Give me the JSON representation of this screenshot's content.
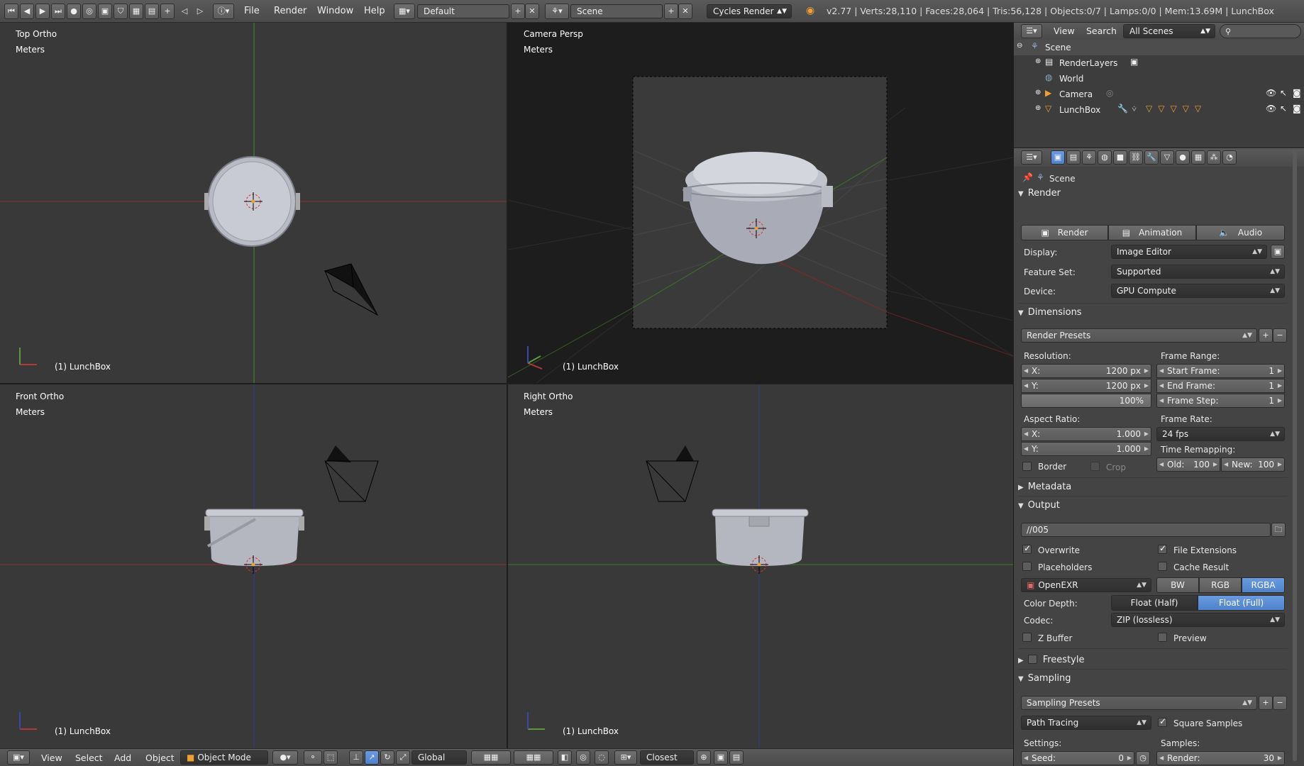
{
  "header": {
    "menus": [
      "File",
      "Render",
      "Window",
      "Help"
    ],
    "screen_layout": "Default",
    "scene": "Scene",
    "engine": "Cycles Render",
    "stats": "v2.77 | Verts:28,110 | Faces:28,064 | Tris:56,128 | Objects:0/7 | Lamps:0/0 | Mem:13.69M | LunchBox"
  },
  "viewports": {
    "top_left": {
      "view": "Top Ortho",
      "units": "Meters",
      "object": "(1) LunchBox"
    },
    "top_right": {
      "view": "Camera Persp",
      "units": "Meters",
      "object": "(1) LunchBox"
    },
    "bottom_left": {
      "view": "Front Ortho",
      "units": "Meters",
      "object": "(1) LunchBox"
    },
    "bottom_right": {
      "view": "Right Ortho",
      "units": "Meters",
      "object": "(1) LunchBox"
    }
  },
  "footer": {
    "menus": [
      "View",
      "Select",
      "Add",
      "Object"
    ],
    "mode": "Object Mode",
    "orientation": "Global",
    "snap": "Closest"
  },
  "outliner": {
    "menus": [
      "View",
      "Search"
    ],
    "filter": "All Scenes",
    "items": [
      "Scene",
      "RenderLayers",
      "World",
      "Camera",
      "LunchBox"
    ]
  },
  "properties": {
    "context": "Scene",
    "render": {
      "title": "Render",
      "buttons": [
        "Render",
        "Animation",
        "Audio"
      ],
      "display_label": "Display:",
      "display": "Image Editor",
      "feature_label": "Feature Set:",
      "feature": "Supported",
      "device_label": "Device:",
      "device": "GPU Compute"
    },
    "dimensions": {
      "title": "Dimensions",
      "presets": "Render Presets",
      "resolution_label": "Resolution:",
      "res_x_key": "X:",
      "res_x": "1200 px",
      "res_y_key": "Y:",
      "res_y": "1200 px",
      "res_pct": "100%",
      "frame_range_label": "Frame Range:",
      "start_key": "Start Frame:",
      "start": "1",
      "end_key": "End Frame:",
      "end": "1",
      "step_key": "Frame Step:",
      "step": "1",
      "aspect_label": "Aspect Ratio:",
      "asp_x_key": "X:",
      "asp_x": "1.000",
      "asp_y_key": "Y:",
      "asp_y": "1.000",
      "frame_rate_label": "Frame Rate:",
      "frame_rate": "24 fps",
      "time_remap_label": "Time Remapping:",
      "old_key": "Old:",
      "old": "100",
      "new_key": "New:",
      "new": "100",
      "border": "Border",
      "crop": "Crop"
    },
    "metadata": {
      "title": "Metadata"
    },
    "output": {
      "title": "Output",
      "path": "//005",
      "overwrite": "Overwrite",
      "file_extensions": "File Extensions",
      "placeholders": "Placeholders",
      "cache_result": "Cache Result",
      "format": "OpenEXR",
      "channels": [
        "BW",
        "RGB",
        "RGBA"
      ],
      "color_depth_label": "Color Depth:",
      "depths": [
        "Float (Half)",
        "Float (Full)"
      ],
      "codec_label": "Codec:",
      "codec": "ZIP (lossless)",
      "zbuffer": "Z Buffer",
      "preview": "Preview"
    },
    "freestyle": {
      "title": "Freestyle"
    },
    "sampling": {
      "title": "Sampling",
      "presets": "Sampling Presets",
      "integrator": "Path Tracing",
      "square_samples": "Square Samples",
      "settings_label": "Settings:",
      "seed_key": "Seed:",
      "seed": "0",
      "samples_label": "Samples:",
      "render_key": "Render:",
      "render": "30"
    }
  },
  "colors": {
    "accent": "#5680c2",
    "x_axis": "#b03838",
    "y_axis": "#5a9a3a",
    "z_axis": "#3a46a8"
  }
}
